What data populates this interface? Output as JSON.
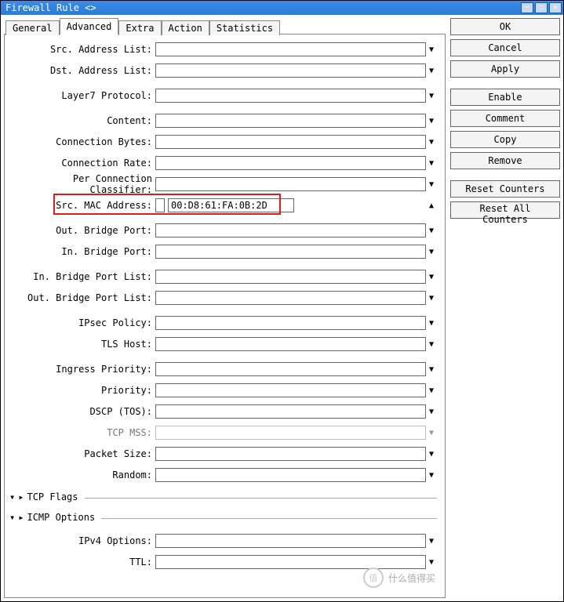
{
  "window": {
    "title": "Firewall Rule <>",
    "min": "─",
    "max": "☐",
    "close": "✕"
  },
  "tabs": {
    "general": "General",
    "advanced": "Advanced",
    "extra": "Extra",
    "action": "Action",
    "statistics": "Statistics"
  },
  "labels": {
    "src_address_list": "Src. Address List:",
    "dst_address_list": "Dst. Address List:",
    "layer7": "Layer7 Protocol:",
    "content": "Content:",
    "conn_bytes": "Connection Bytes:",
    "conn_rate": "Connection Rate:",
    "pcc": "Per Connection Classifier:",
    "src_mac": "Src. MAC Address:",
    "out_bridge_port": "Out. Bridge Port:",
    "in_bridge_port": "In. Bridge Port:",
    "in_bridge_port_list": "In. Bridge Port List:",
    "out_bridge_port_list": "Out. Bridge Port List:",
    "ipsec_policy": "IPsec Policy:",
    "tls_host": "TLS Host:",
    "ingress_priority": "Ingress Priority:",
    "priority": "Priority:",
    "dscp": "DSCP (TOS):",
    "tcp_mss": "TCP MSS:",
    "packet_size": "Packet Size:",
    "random": "Random:",
    "ipv4_options": "IPv4 Options:",
    "ttl": "TTL:"
  },
  "values": {
    "src_mac": "00:D8:61:FA:0B:2D"
  },
  "expand": {
    "tcp_flags": "TCP Flags",
    "icmp_options": "ICMP Options"
  },
  "buttons": {
    "ok": "OK",
    "cancel": "Cancel",
    "apply": "Apply",
    "enable": "Enable",
    "comment": "Comment",
    "copy": "Copy",
    "remove": "Remove",
    "reset_counters": "Reset Counters",
    "reset_all_counters": "Reset All Counters"
  },
  "watermark": {
    "symbol": "值",
    "text": "什么值得买"
  }
}
